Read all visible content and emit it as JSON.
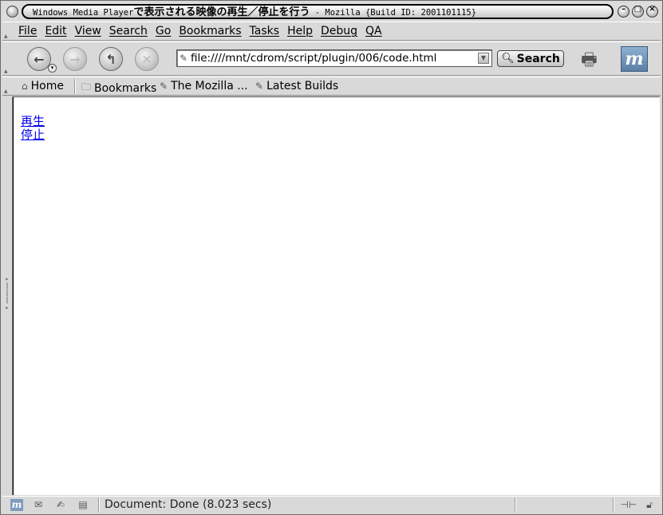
{
  "window": {
    "title_prefix": "Windows Media Player",
    "title_jp": "で表示される映像の再生／停止を行う",
    "title_suffix": " - Mozilla {Build ID: 2001101115}"
  },
  "menubar": {
    "items": [
      "File",
      "Edit",
      "View",
      "Search",
      "Go",
      "Bookmarks",
      "Tasks",
      "Help",
      "Debug",
      "QA"
    ]
  },
  "navbar": {
    "url_value": "file:////mnt/cdrom/script/plugin/006/code.html",
    "search_label": "Search"
  },
  "personalbar": {
    "home": "Home",
    "bookmarks": "Bookmarks",
    "mozilla": "The Mozilla ...",
    "latest": "Latest Builds"
  },
  "content": {
    "links": [
      "再生",
      "停止"
    ]
  },
  "statusbar": {
    "text": "Document: Done (8.023 secs)"
  },
  "icons": {
    "back": "back-arrow-icon",
    "forward": "forward-arrow-icon",
    "reload": "reload-icon",
    "stop": "stop-icon",
    "search": "magnifier-icon",
    "print": "print-icon",
    "logo": "mozilla-logo-icon"
  }
}
